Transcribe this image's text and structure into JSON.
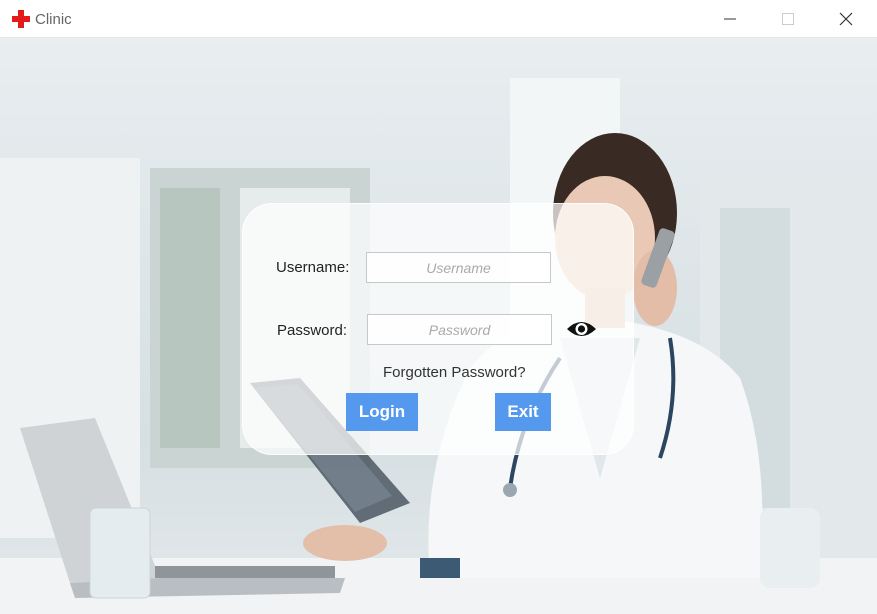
{
  "window": {
    "title": "Clinic",
    "icon": "red-cross-icon",
    "accent_color": "#e21b1b"
  },
  "login": {
    "username_label": "Username:",
    "username_placeholder": "Username",
    "password_label": "Password:",
    "password_placeholder": "Password",
    "forgot_label": "Forgotten Password?",
    "login_label": "Login",
    "exit_label": "Exit",
    "button_color": "#5599ee"
  }
}
